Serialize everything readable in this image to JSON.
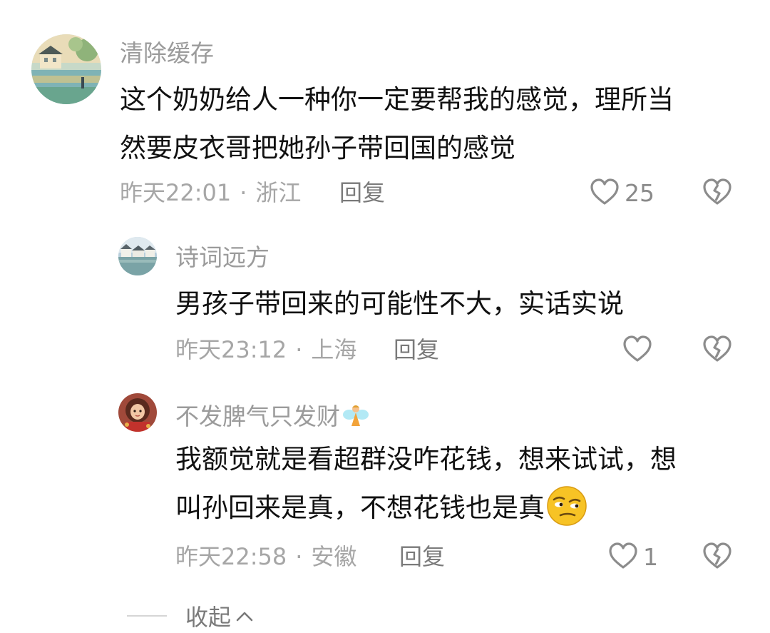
{
  "comments": [
    {
      "username": "清除缓存",
      "content_lines": [
        "这个奶奶给人一种你一定要帮我的感觉，理所当",
        "然要皮衣哥把她孙子带回国的感觉"
      ],
      "time": "昨天22:01",
      "location": "浙江",
      "separator": "·",
      "reply_label": "回复",
      "like_count": "25",
      "avatar_icon": "landscape-painting-avatar"
    },
    {
      "username": "诗词远方",
      "content_lines": [
        "男孩子带回来的可能性不大，实话实说"
      ],
      "time": "昨天23:12",
      "location": "上海",
      "separator": "·",
      "reply_label": "回复",
      "like_count": "",
      "avatar_icon": "river-town-avatar"
    },
    {
      "username": "不发脾气只发财",
      "username_emoji": "fairy-emoji",
      "content_lines": [
        "我额觉就是看超群没咋花钱，想来试试，想",
        "叫孙回来是真，不想花钱也是真"
      ],
      "content_emoji": "skeptical-face-emoji",
      "time": "昨天22:58",
      "location": "安徽",
      "separator": "·",
      "reply_label": "回复",
      "like_count": "1",
      "avatar_icon": "girl-portrait-avatar"
    }
  ],
  "collapse_label": "收起",
  "icons": {
    "like": "heart-outline-icon",
    "dislike": "broken-heart-icon",
    "collapse": "chevron-up-icon"
  },
  "colors": {
    "text": "#111111",
    "muted": "#9b9b9b",
    "icon": "#8c8c8c"
  }
}
